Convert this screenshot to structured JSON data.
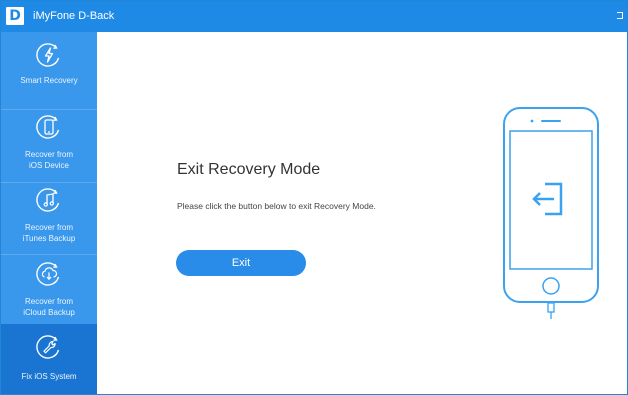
{
  "window": {
    "logo_letter": "D",
    "title": "iMyFone D-Back"
  },
  "sidebar": {
    "items": [
      {
        "label_line1": "Smart Recovery",
        "label_line2": "",
        "icon": "lightning-icon",
        "active": false
      },
      {
        "label_line1": "Recover from",
        "label_line2": "iOS Device",
        "icon": "phone-icon",
        "active": false
      },
      {
        "label_line1": "Recover from",
        "label_line2": "iTunes Backup",
        "icon": "music-note-icon",
        "active": false
      },
      {
        "label_line1": "Recover from",
        "label_line2": "iCloud Backup",
        "icon": "cloud-download-icon",
        "active": false
      },
      {
        "label_line1": "Fix iOS System",
        "label_line2": "",
        "icon": "wrench-icon",
        "active": true
      }
    ]
  },
  "main": {
    "heading": "Exit Recovery Mode",
    "description": "Please click the button below to exit Recovery Mode.",
    "exit_button": "Exit"
  },
  "colors": {
    "titlebar": "#1f8ae6",
    "sidebar": "#3a98ec",
    "sidebar_active": "#1a75d2",
    "button": "#2a8ce9",
    "phone_outline": "#3aa2f0"
  }
}
